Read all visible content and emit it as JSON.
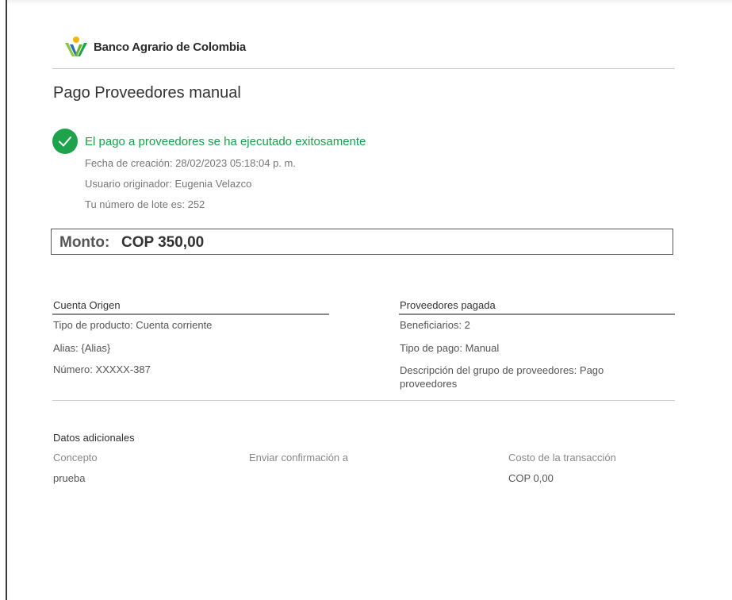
{
  "brand": {
    "name": "Banco Agrario de Colombia",
    "colors": {
      "green": "#1ea24c",
      "yellow": "#f2b705",
      "blue": "#2a6fb5",
      "lime": "#8cc63f"
    }
  },
  "title": "Pago Proveedores manual",
  "status": {
    "icon": "check-icon",
    "message": "El pago a proveedores se ha ejecutado exitosamente",
    "color": "#19a04a"
  },
  "meta": {
    "fecha": "Fecha de creación: 28/02/2023 05:18:04 p. m.",
    "usuario": "Usuario originador: Eugenia Velazco",
    "lote": "Tu número de lote es: 252"
  },
  "amount": {
    "label": "Monto:",
    "value": "COP 350,00"
  },
  "cuenta_origen": {
    "title": "Cuenta Origen",
    "rows": [
      "Tipo de producto: Cuenta corriente",
      "Alias: {Alias}",
      "Número: XXXXX-387"
    ]
  },
  "proveedores": {
    "title": "Proveedores pagada",
    "rows": [
      "Beneficiarios: 2",
      "Tipo de pago: Manual",
      "Descripción del grupo de proveedores: Pago proveedores"
    ]
  },
  "datos_adicionales": {
    "title": "Datos adicionales",
    "concepto_label": "Concepto",
    "concepto_value": "prueba",
    "confirmacion_label": "Enviar confirmación a",
    "costo_label": "Costo de la transacción",
    "costo_value": "COP 0,00"
  }
}
